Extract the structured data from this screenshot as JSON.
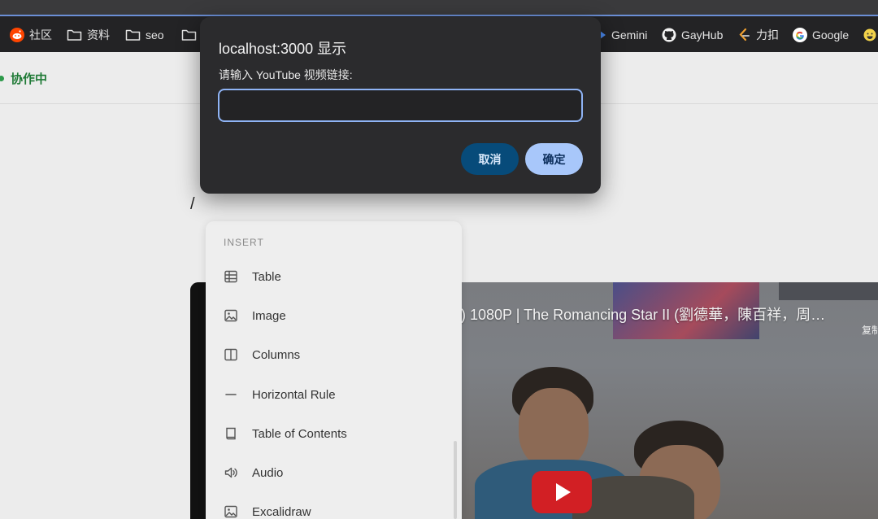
{
  "bookmarks": [
    {
      "label": "社区",
      "icon": "reddit-icon"
    },
    {
      "label": "资料",
      "icon": "folder-icon"
    },
    {
      "label": "seo",
      "icon": "folder-icon"
    },
    {
      "label": "",
      "icon": "folder-icon"
    },
    {
      "label": "Gemini",
      "icon": "gemini-icon"
    },
    {
      "label": "GayHub",
      "icon": "github-icon"
    },
    {
      "label": "力扣",
      "icon": "leetcode-icon"
    },
    {
      "label": "Google",
      "icon": "google-icon"
    },
    {
      "label": "",
      "icon": "emoji-icon"
    }
  ],
  "page": {
    "collab_status": "协作中",
    "slash": "/"
  },
  "insert_menu": {
    "heading": "INSERT",
    "items": [
      {
        "label": "Table",
        "icon": "table-icon"
      },
      {
        "label": "Image",
        "icon": "image-icon"
      },
      {
        "label": "Columns",
        "icon": "columns-icon"
      },
      {
        "label": "Horizontal Rule",
        "icon": "horizontal-rule-icon"
      },
      {
        "label": "Table of Contents",
        "icon": "book-icon"
      },
      {
        "label": "Audio",
        "icon": "speaker-icon"
      },
      {
        "label": "Excalidraw",
        "icon": "image-icon"
      }
    ]
  },
  "video": {
    "title": ") 1080P | The Romancing Star II (劉德華，陳百祥，周…",
    "copy_label": "复制"
  },
  "dialog": {
    "title": "localhost:3000 显示",
    "message": "请输入 YouTube 视频链接:",
    "input_value": "",
    "cancel_label": "取消",
    "ok_label": "确定"
  },
  "colors": {
    "accent": "#a8c7fa",
    "cancel": "#074b7a",
    "collab": "#1f7a36",
    "play": "#d21f24"
  }
}
